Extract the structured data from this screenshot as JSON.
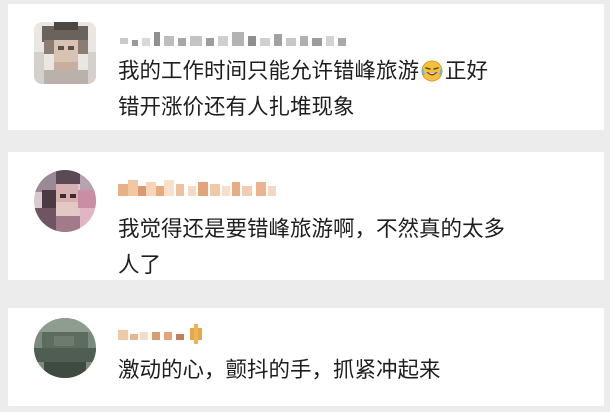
{
  "comments": [
    {
      "text_before_emoji": "我的工作时间只能允许错峰旅游",
      "emoji": "laughing-tears",
      "text_after_emoji": "正好\n错开涨价还有人扎堆现象"
    },
    {
      "text": "我觉得还是要错峰旅游啊，不然真的太多\n人了"
    },
    {
      "text": "激动的心，颤抖的手，抓紧冲起来"
    }
  ]
}
